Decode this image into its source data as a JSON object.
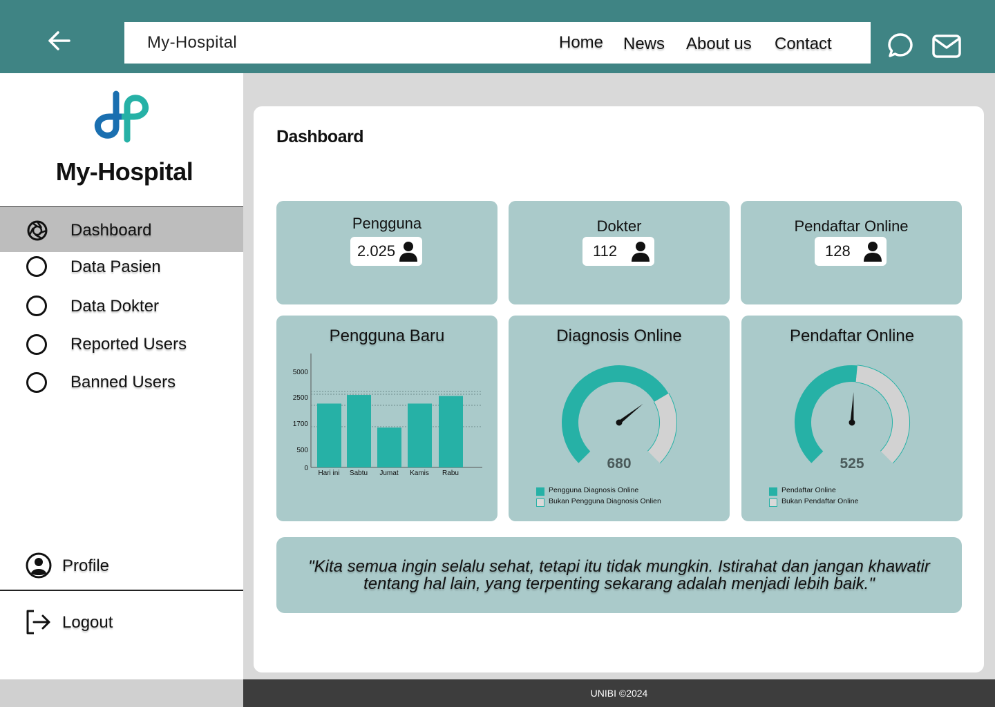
{
  "header": {
    "brand": "My-Hospital",
    "nav": [
      "Home",
      "News",
      "About us",
      "Contact"
    ],
    "icons": [
      "arrow-left-icon",
      "chat-icon",
      "mail-icon"
    ]
  },
  "sidebar": {
    "brand": "My-Hospital",
    "items": [
      {
        "label": "Dashboard",
        "icon": "aperture-icon",
        "active": true
      },
      {
        "label": "Data Pasien",
        "icon": "circle-icon"
      },
      {
        "label": "Data Dokter",
        "icon": "circle-icon"
      },
      {
        "label": "Reported Users",
        "icon": "circle-icon"
      },
      {
        "label": "Banned Users",
        "icon": "circle-icon"
      }
    ],
    "profile": "Profile",
    "logout": "Logout"
  },
  "main": {
    "title": "Dashboard",
    "stats": [
      {
        "label": "Pengguna",
        "value": "2.025"
      },
      {
        "label": "Dokter",
        "value": "112"
      },
      {
        "label": "Pendaftar Online",
        "value": "128"
      }
    ],
    "quote": "\"Kita semua ingin selalu sehat, tetapi itu tidak mungkin. Istirahat dan jangan khawatir tentang hal lain, yang terpenting sekarang adalah menjadi lebih baik.\""
  },
  "chart_data": [
    {
      "type": "bar",
      "title": "Pengguna Baru",
      "categories": [
        "Hari ini",
        "Sabtu",
        "Jumat",
        "Kamis",
        "Rabu"
      ],
      "values": [
        2300,
        2700,
        1500,
        2300,
        2600
      ],
      "y_ticks": [
        "5000",
        "2500",
        "1700",
        "500",
        "0"
      ],
      "grid": true,
      "bar_color": "#26b1a6"
    },
    {
      "type": "gauge",
      "title": "Diagnosis Online",
      "value": 680,
      "fraction": 0.72,
      "legend": [
        "Pengguna Diagnosis Online",
        "Bukan Pengguna Diagnosis Onlien"
      ],
      "colors": [
        "#26b1a6",
        "#d2d2d2"
      ]
    },
    {
      "type": "gauge",
      "title": "Pendaftar Online",
      "value": 525,
      "fraction": 0.52,
      "legend": [
        "Pendaftar Online",
        "Bukan Pendaftar Online"
      ],
      "colors": [
        "#26b1a6",
        "#d2d2d2"
      ]
    }
  ],
  "footer": {
    "text": "UNIBI ©2024"
  },
  "colors": {
    "header": "#3f8484",
    "card": "#aacaca",
    "accent": "#26b1a6",
    "footer": "#3d3d3d"
  }
}
